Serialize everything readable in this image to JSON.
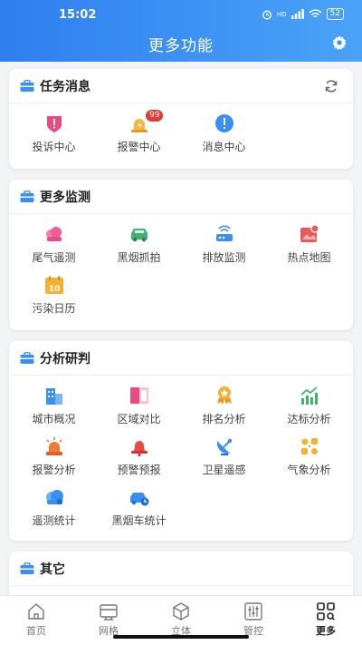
{
  "status": {
    "time": "15:02",
    "signal": "HD",
    "battery": "52"
  },
  "header": {
    "title": "更多功能"
  },
  "sections": [
    {
      "title": "任务消息",
      "items": [
        {
          "label": "投诉中心",
          "icon": "complaint-icon"
        },
        {
          "label": "报警中心",
          "icon": "alarm-icon",
          "badge": "99"
        },
        {
          "label": "消息中心",
          "icon": "message-icon"
        }
      ]
    },
    {
      "title": "更多监测",
      "items": [
        {
          "label": "尾气遥测",
          "icon": "exhaust-icon"
        },
        {
          "label": "黑烟抓拍",
          "icon": "smoke-capture-icon"
        },
        {
          "label": "排放监测",
          "icon": "emission-icon"
        },
        {
          "label": "热点地图",
          "icon": "hotspot-map-icon"
        },
        {
          "label": "污染日历",
          "icon": "calendar-icon",
          "day": "10"
        }
      ]
    },
    {
      "title": "分析研判",
      "items": [
        {
          "label": "城市概况",
          "icon": "city-icon"
        },
        {
          "label": "区域对比",
          "icon": "compare-icon"
        },
        {
          "label": "排名分析",
          "icon": "ranking-icon"
        },
        {
          "label": "达标分析",
          "icon": "trend-icon"
        },
        {
          "label": "报警分析",
          "icon": "siren-icon"
        },
        {
          "label": "预警预报",
          "icon": "bell-icon"
        },
        {
          "label": "卫星遥感",
          "icon": "satellite-icon"
        },
        {
          "label": "气象分析",
          "icon": "weather-icon"
        },
        {
          "label": "遥测统计",
          "icon": "telemetry-icon"
        },
        {
          "label": "黑烟车统计",
          "icon": "smoke-car-icon"
        }
      ]
    },
    {
      "title": "其它",
      "items": []
    }
  ],
  "tabs": [
    {
      "label": "首页",
      "icon": "home-icon",
      "active": false
    },
    {
      "label": "网格",
      "icon": "grid-icon",
      "active": false
    },
    {
      "label": "立体",
      "icon": "cube-icon",
      "active": false
    },
    {
      "label": "管控",
      "icon": "control-icon",
      "active": false
    },
    {
      "label": "更多",
      "icon": "more-icon",
      "active": true
    }
  ],
  "colors": {
    "header_start": "#2f7ef0",
    "header_end": "#4aa3f7",
    "badge": "#e53935"
  }
}
